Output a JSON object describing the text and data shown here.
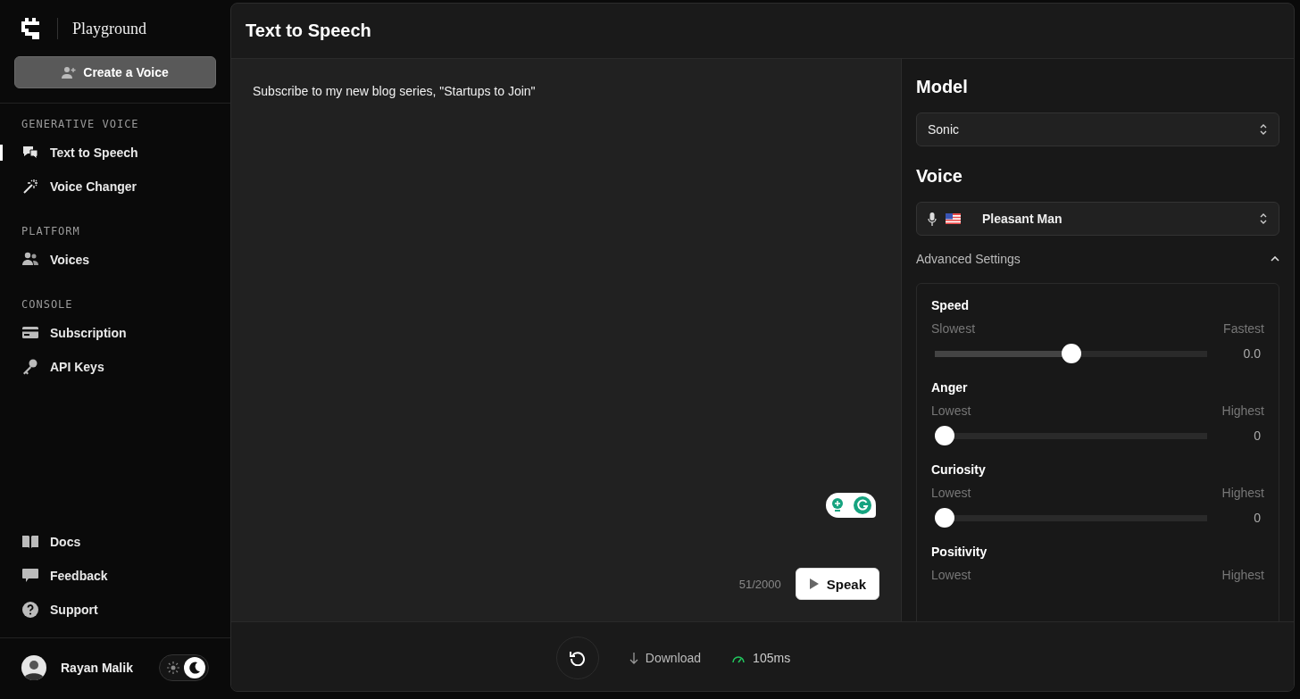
{
  "brand": {
    "name": "Playground"
  },
  "create_button": {
    "label": "Create a Voice"
  },
  "sidebar": {
    "sections": [
      {
        "heading": "GENERATIVE VOICE",
        "items": [
          {
            "label": "Text to Speech",
            "selected": true
          },
          {
            "label": "Voice Changer",
            "selected": false
          }
        ]
      },
      {
        "heading": "PLATFORM",
        "items": [
          {
            "label": "Voices",
            "selected": false
          }
        ]
      },
      {
        "heading": "CONSOLE",
        "items": [
          {
            "label": "Subscription",
            "selected": false
          },
          {
            "label": "API Keys",
            "selected": false
          }
        ]
      }
    ],
    "bottom_items": [
      {
        "label": "Docs",
        "selected": false
      },
      {
        "label": "Feedback",
        "selected": false
      },
      {
        "label": "Support",
        "selected": false
      }
    ]
  },
  "user": {
    "name": "Rayan Malik"
  },
  "theme_toggle": {
    "dark": true
  },
  "page": {
    "title": "Text to Speech"
  },
  "editor": {
    "text": "Subscribe to my new blog series, \"Startups to Join\"",
    "count": "51/2000",
    "speak_button": "Speak"
  },
  "footer": {
    "download": "Download",
    "latency": "105ms"
  },
  "settings": {
    "model_heading": "Model",
    "model": "Sonic",
    "voice_heading": "Voice",
    "voice": "Pleasant Man",
    "advanced": {
      "label": "Advanced Settings",
      "expanded": true
    },
    "sliders": [
      {
        "name": "Speed",
        "low": "Slowest",
        "high": "Fastest",
        "level": 0.5,
        "reading": "0.0"
      },
      {
        "name": "Anger",
        "low": "Lowest",
        "high": "Highest",
        "level": 0,
        "reading": "0"
      },
      {
        "name": "Curiosity",
        "low": "Lowest",
        "high": "Highest",
        "level": 0,
        "reading": "0"
      },
      {
        "name": "Positivity",
        "low": "Lowest",
        "high": "Highest"
      }
    ]
  }
}
